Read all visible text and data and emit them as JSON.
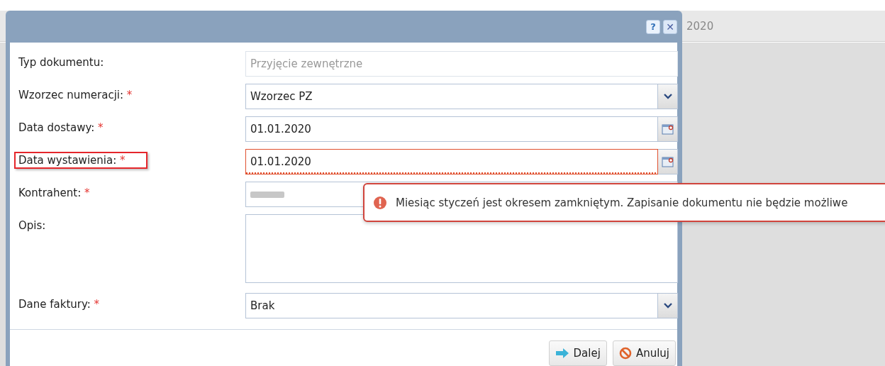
{
  "background": {
    "header_text": "2020"
  },
  "dialog": {
    "tools": [
      {
        "kind": "help",
        "label": "?"
      },
      {
        "kind": "close",
        "label": "✕"
      }
    ],
    "fields": [
      {
        "label": "Typ dokumentu:",
        "highlighted": false,
        "kind": "readonly",
        "value": "Przyjęcie zewnętrzne",
        "invalid": false
      },
      {
        "label": "Wzorzec numeracji:",
        "required_mark": "*",
        "highlighted": false,
        "kind": "combo",
        "value": "Wzorzec PZ",
        "invalid": false
      },
      {
        "label": "Data dostawy:",
        "required_mark": "*",
        "highlighted": false,
        "kind": "date",
        "value": "01.01.2020",
        "invalid": false
      },
      {
        "label": "Data wystawienia:",
        "required_mark": "*",
        "highlighted": true,
        "kind": "date",
        "value": "01.01.2020",
        "invalid": true
      },
      {
        "label": "Kontrahent:",
        "required_mark": "*",
        "highlighted": false,
        "kind": "redacted",
        "invalid": false
      },
      {
        "label": "Opis:",
        "highlighted": false,
        "kind": "textarea",
        "invalid": false
      },
      {
        "label": "Dane faktury:",
        "required_mark": "*",
        "highlighted": false,
        "kind": "combo",
        "value": "Brak",
        "invalid": false
      }
    ],
    "buttons": [
      {
        "kind": "next",
        "label": "Dalej"
      },
      {
        "kind": "cancel",
        "label": "Anuluj"
      }
    ]
  },
  "tooltip": {
    "text": "Miesiąc styczeń jest okresem zamkniętym. Zapisanie dokumentu nie będzie możliwe"
  }
}
